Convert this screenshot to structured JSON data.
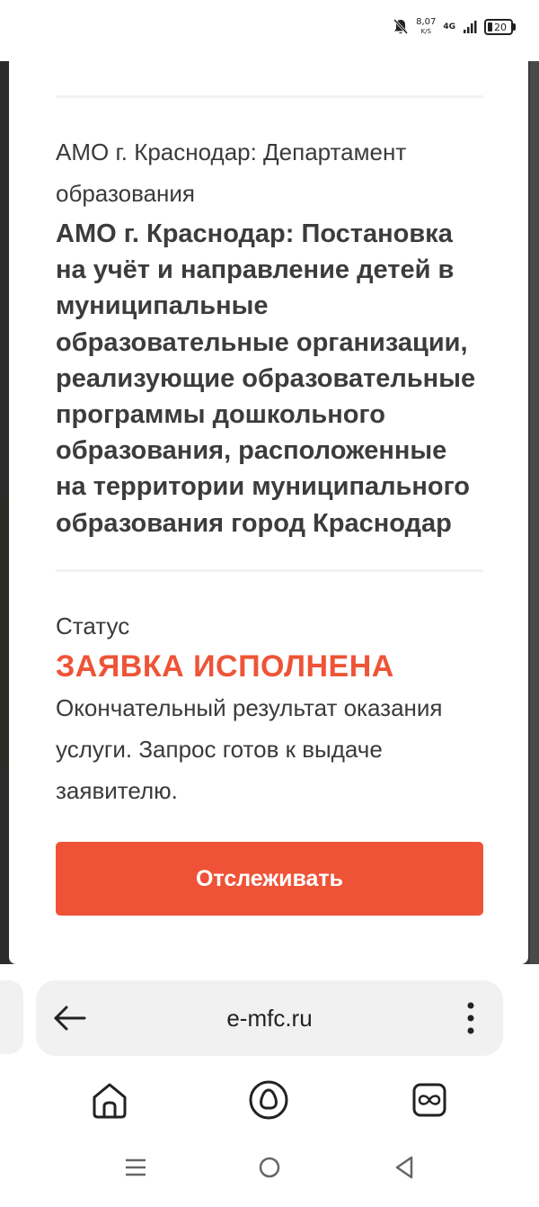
{
  "status_bar": {
    "speed_value": "8,07",
    "speed_unit": "K/S",
    "network": "4G",
    "battery": "20"
  },
  "card": {
    "department": "АМО г. Краснодар: Департамент образования",
    "service_title": "АМО г. Краснодар: Постановка на учёт и направление детей в муниципальные образовательные организации, реализующие образовательные программы дошкольного образования, расположенные на территории муниципального образования город Краснодар",
    "status_label": "Статус",
    "status_value": "ЗАЯВКА ИСПОЛНЕНА",
    "status_description": "Окончательный результат оказания услуги. Запрос готов к выдаче заявителю.",
    "track_button": "Отслеживать"
  },
  "browser": {
    "url": "e-mfc.ru",
    "icons": [
      "back-arrow-icon",
      "more-vertical-icon",
      "home-icon",
      "alice-icon",
      "tabs-icon"
    ]
  },
  "system_nav": {
    "icons": [
      "menu-icon",
      "home-circle-icon",
      "back-triangle-icon"
    ]
  },
  "colors": {
    "accent": "#ef5337",
    "status_text": "#ee5437"
  }
}
